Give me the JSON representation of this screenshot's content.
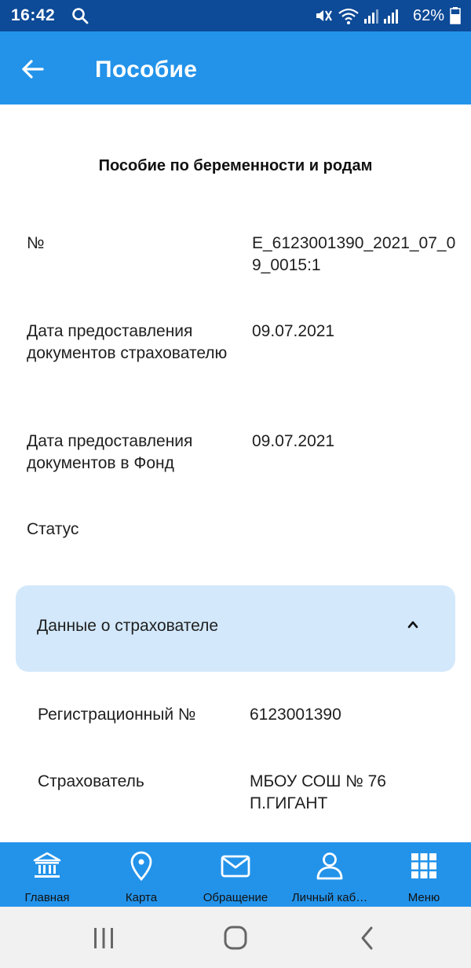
{
  "status_bar": {
    "time": "16:42",
    "battery_text": "62%",
    "icons": [
      "search-icon",
      "mute-icon",
      "wifi-icon",
      "signal-icon",
      "battery-icon"
    ]
  },
  "app_bar": {
    "title": "Пособие",
    "back_icon": "arrow-left-icon"
  },
  "page": {
    "heading": "Пособие по беременности и родам",
    "rows": [
      {
        "label": "№",
        "value": "Е_6123001390_2021_07_09_0015:1"
      },
      {
        "label": "Дата предоставления документов страхователю",
        "value": "09.07.2021"
      },
      {
        "label": "Дата предоставления документов в Фонд",
        "value": "09.07.2021"
      },
      {
        "label": "Статус",
        "value": ""
      }
    ]
  },
  "accordion": {
    "title": "Данные о страхователе",
    "expanded": true,
    "chevron_icon": "chevron-up-icon",
    "rows": [
      {
        "label": "Регистрационный №",
        "value": "6123001390"
      },
      {
        "label": "Страхователь",
        "value": "МБОУ СОШ № 76 П.ГИГАНТ"
      }
    ]
  },
  "bottom_nav": {
    "items": [
      {
        "label": "Главная",
        "icon": "bank-icon"
      },
      {
        "label": "Карта",
        "icon": "map-pin-icon"
      },
      {
        "label": "Обращение",
        "icon": "mail-icon"
      },
      {
        "label": "Личный каб…",
        "icon": "user-icon"
      },
      {
        "label": "Меню",
        "icon": "grid-icon"
      }
    ]
  },
  "colors": {
    "status_bar": "#0d4a97",
    "primary": "#2393ea",
    "accordion_bg": "#d3e8fb",
    "system_nav_bg": "#f1f1f1"
  }
}
